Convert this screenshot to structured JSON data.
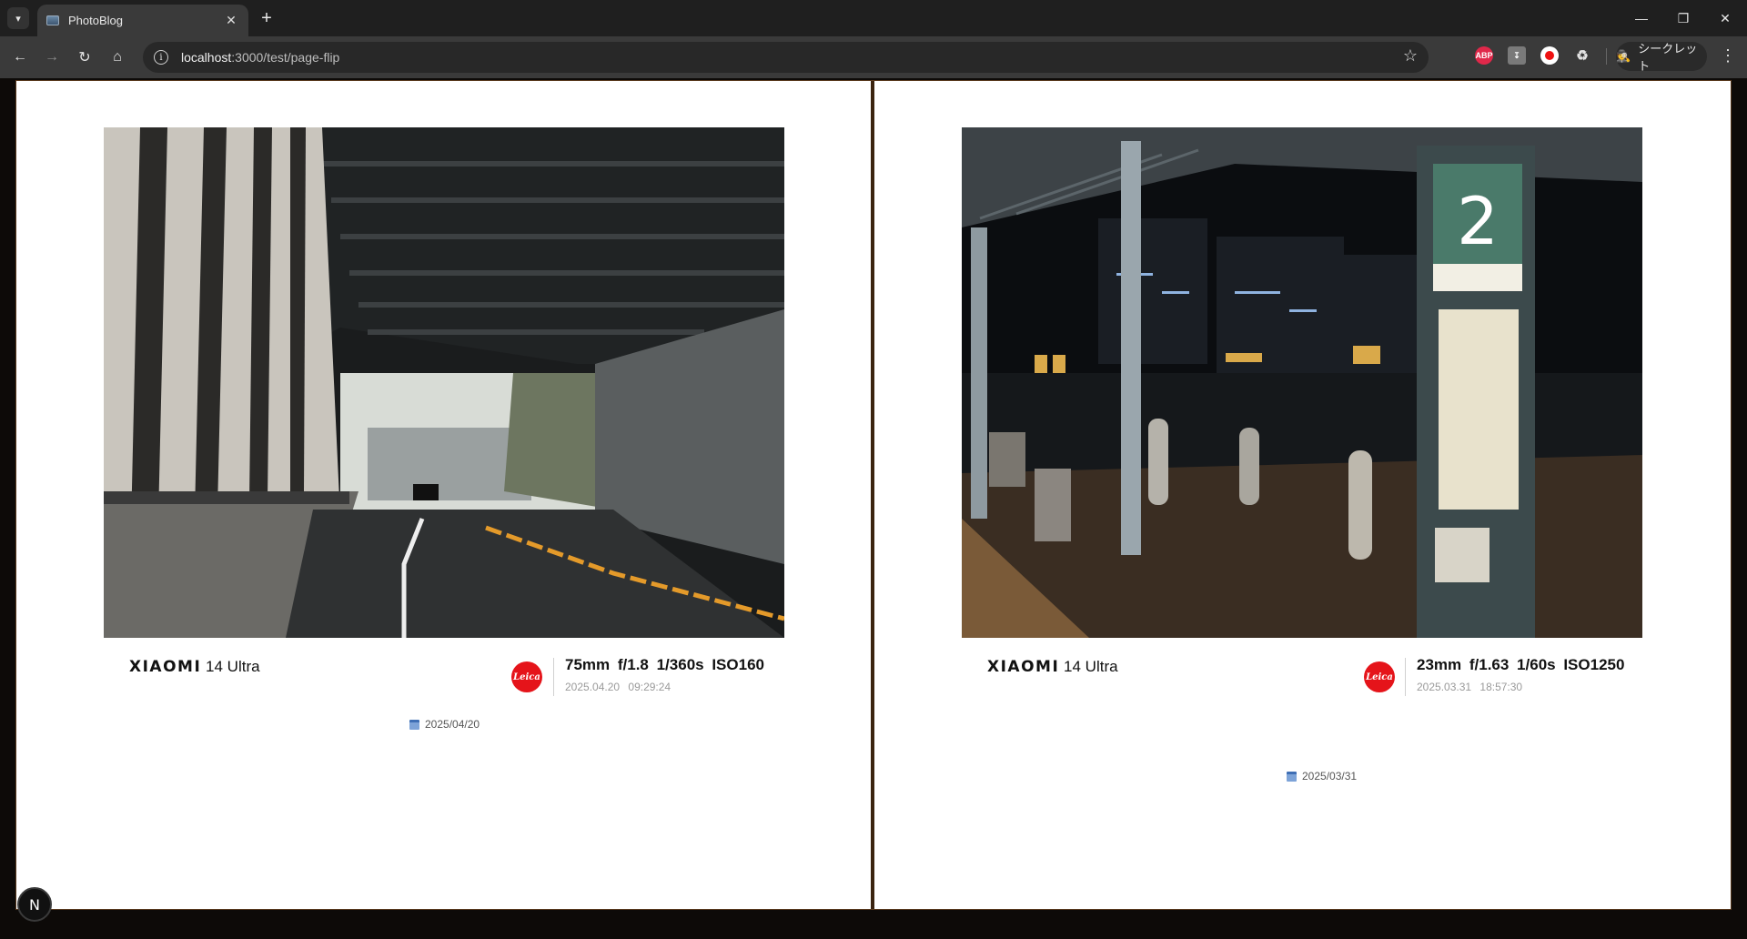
{
  "browser": {
    "tab_title": "PhotoBlog",
    "url_host": "localhost",
    "url_path": ":3000/test/page-flip",
    "profile_label": "シークレット",
    "ext_abp": "ABP"
  },
  "pages": [
    {
      "camera_brand": "XIAOMI",
      "camera_model": "14 Ultra",
      "params": "75mm  f/1.8  1/360s  ISO160",
      "timestamp": "2025.04.20  09:29:24",
      "date": "2025/04/20"
    },
    {
      "camera_brand": "XIAOMI",
      "camera_model": "14 Ultra",
      "params": "23mm  f/1.63  1/60s  ISO1250",
      "timestamp": "2025.03.31  18:57:30",
      "date": "2025/03/31"
    }
  ],
  "badge_letter": "N",
  "colors": {
    "leica_red": "#e5141a",
    "book_border": "#5a3a1f"
  }
}
